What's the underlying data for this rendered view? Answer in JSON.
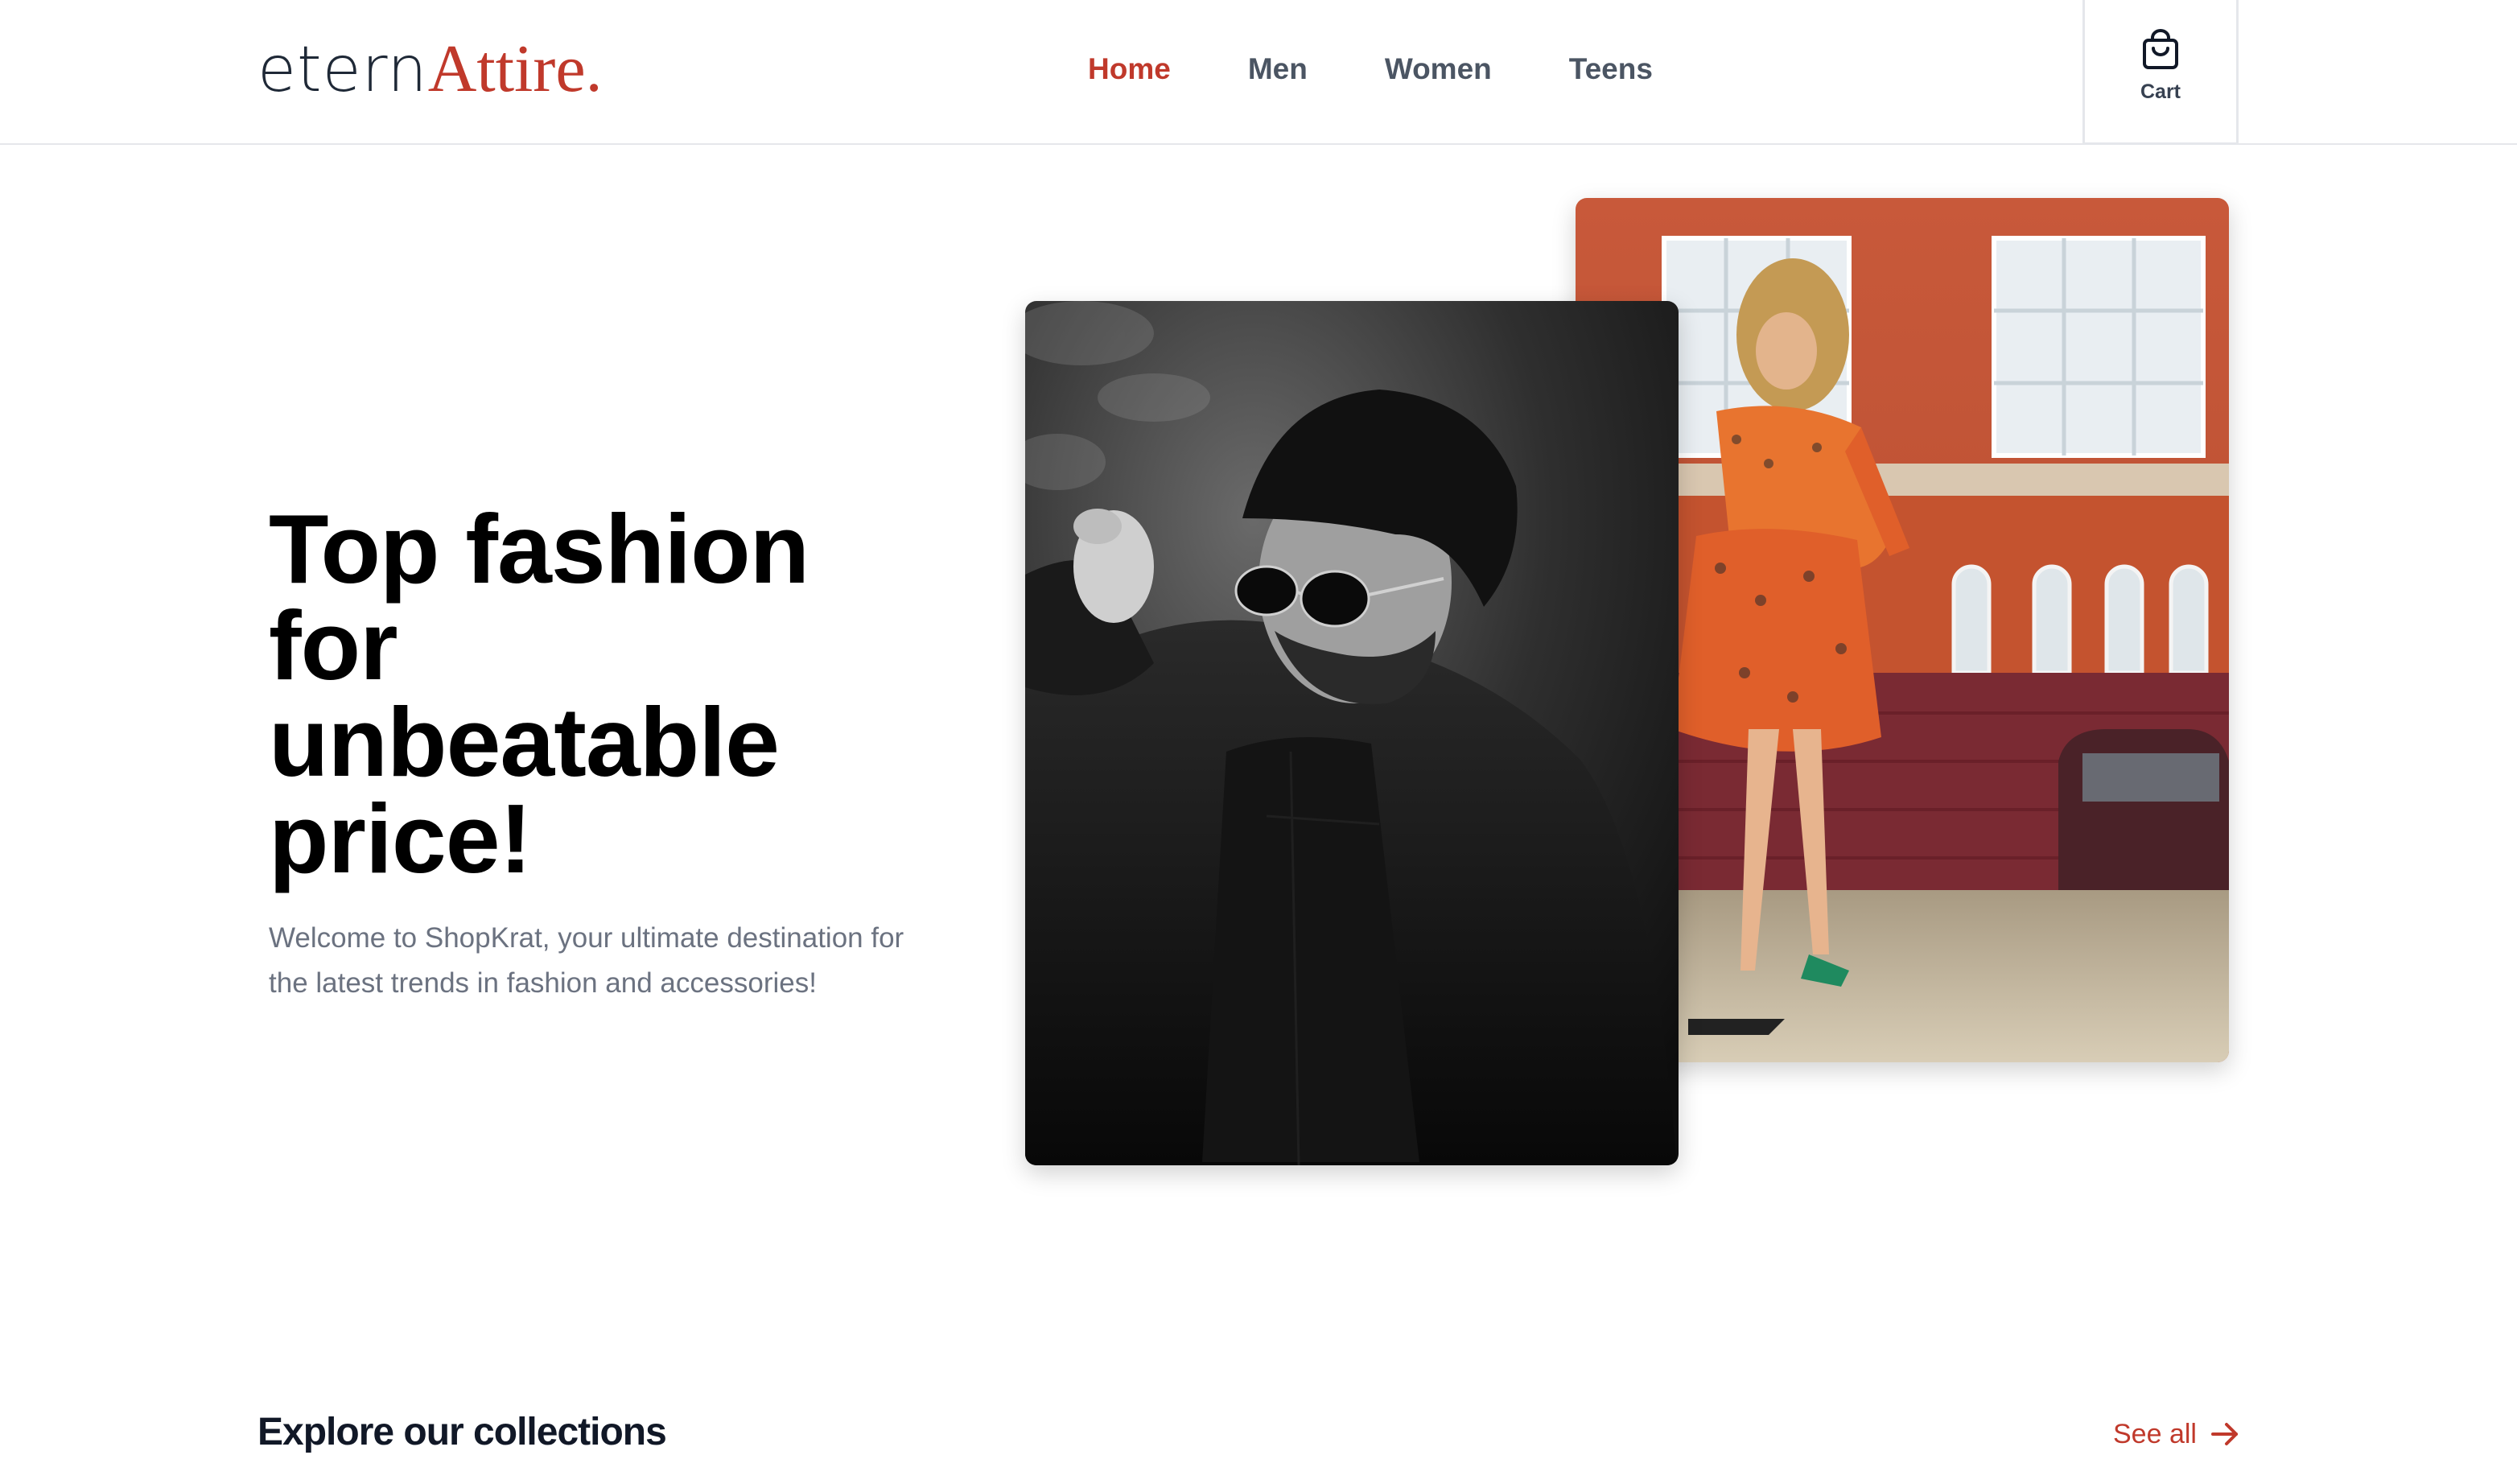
{
  "header": {
    "logo": {
      "part1": "etern",
      "part2": "Attire."
    },
    "nav": [
      {
        "label": "Home",
        "active": true
      },
      {
        "label": "Men",
        "active": false
      },
      {
        "label": "Women",
        "active": false
      },
      {
        "label": "Teens",
        "active": false
      }
    ],
    "cart": {
      "label": "Cart",
      "icon": "shopping-bag-icon"
    }
  },
  "hero": {
    "title": "Top fashion for unbeatable price!",
    "subtitle": "Welcome to ShopKrat, your ultimate destination for the latest trends in fashion and accessories!"
  },
  "collections": {
    "title": "Explore our collections",
    "see_all": "See all",
    "see_all_icon": "arrow-right-icon"
  },
  "colors": {
    "accent": "#c0392b",
    "nav_text": "#4b5563",
    "body_text": "#6b7280",
    "border": "#e5e7eb"
  }
}
